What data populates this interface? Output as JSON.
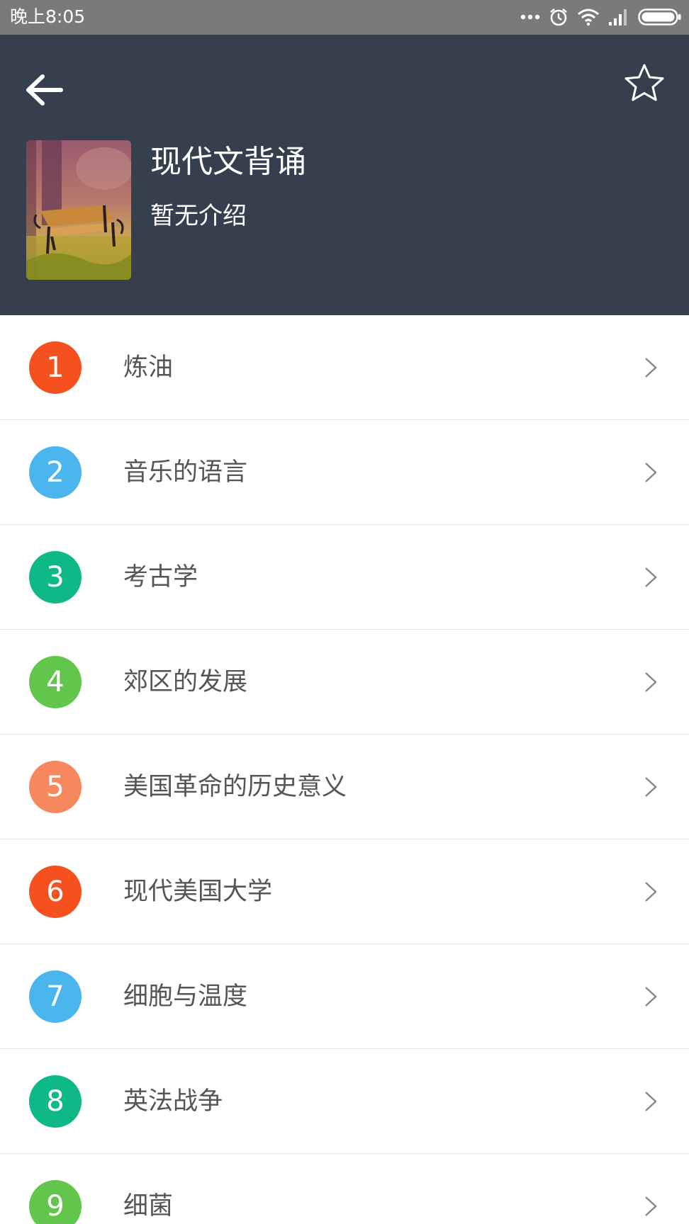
{
  "status_bar": {
    "time": "晚上8:05",
    "icons": [
      "more-dots-icon",
      "alarm-icon",
      "wifi-icon",
      "signal-icon",
      "battery-icon"
    ]
  },
  "header": {
    "background": "#363f4e",
    "back_icon": "arrow-left-icon",
    "favorite_icon": "star-outline-icon",
    "title": "现代文背诵",
    "description": "暂无介绍",
    "cover": "park-bench-image"
  },
  "chapters": [
    {
      "number": "1",
      "title": "炼油",
      "color": "#f4511e"
    },
    {
      "number": "2",
      "title": "音乐的语言",
      "color": "#4bb6ed"
    },
    {
      "number": "3",
      "title": "考古学",
      "color": "#0fb887"
    },
    {
      "number": "4",
      "title": "郊区的发展",
      "color": "#63c64c"
    },
    {
      "number": "5",
      "title": "美国革命的历史意义",
      "color": "#f7875f"
    },
    {
      "number": "6",
      "title": "现代美国大学",
      "color": "#f4511e"
    },
    {
      "number": "7",
      "title": "细胞与温度",
      "color": "#4bb6ed"
    },
    {
      "number": "8",
      "title": "英法战争",
      "color": "#0fb887"
    },
    {
      "number": "9",
      "title": "细菌",
      "color": "#63c64c"
    }
  ]
}
